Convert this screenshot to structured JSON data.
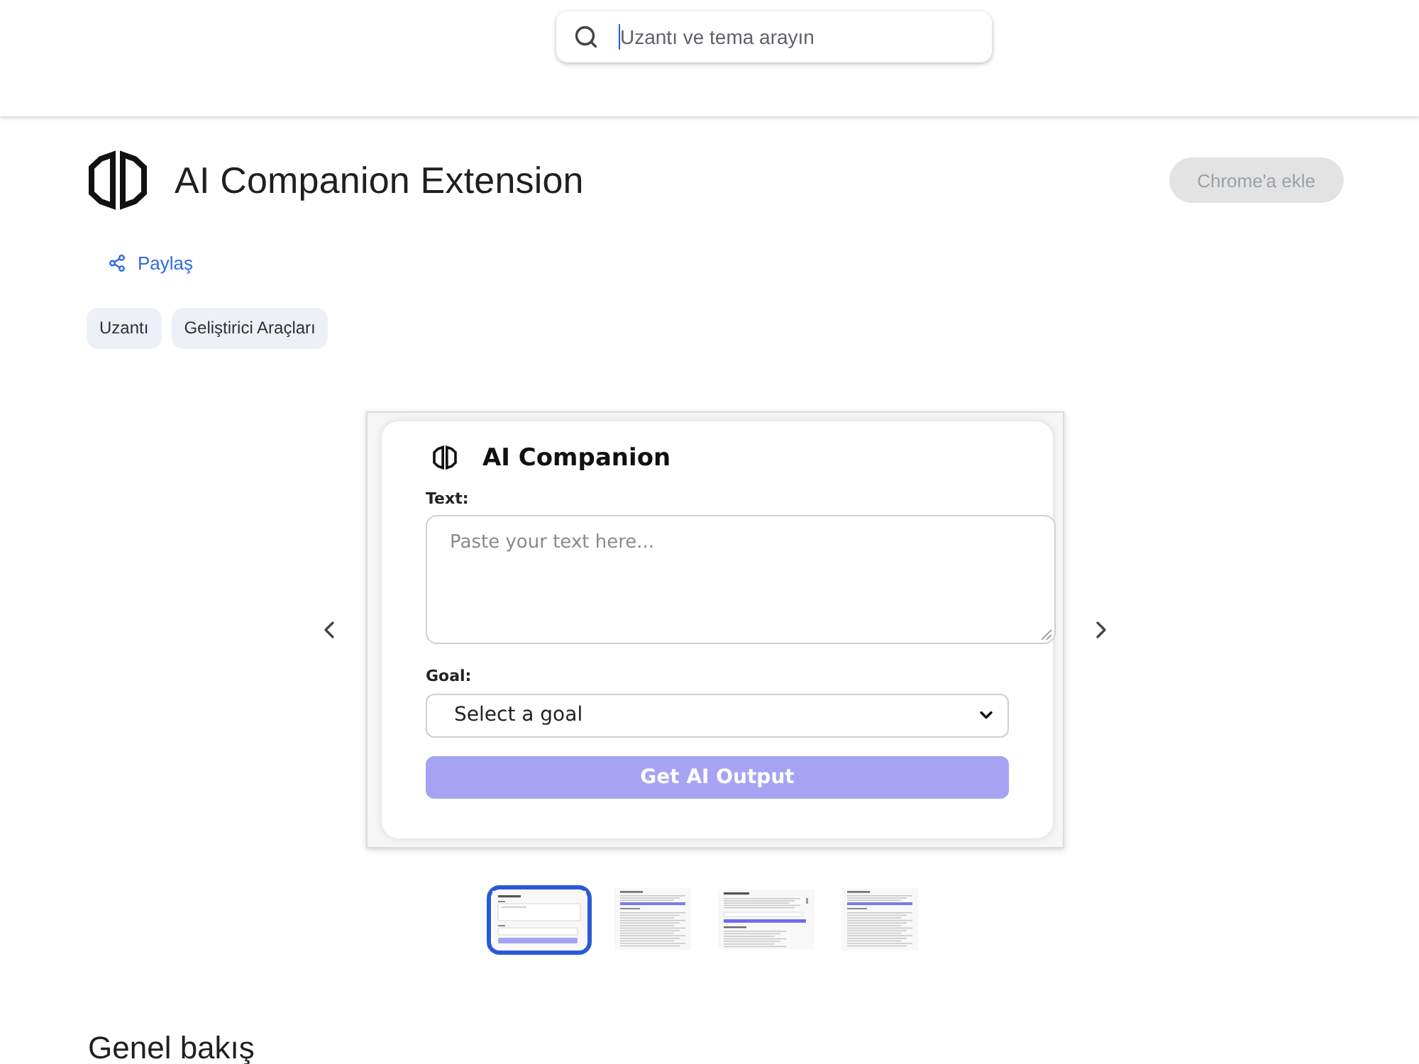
{
  "search": {
    "placeholder": "Uzantı ve tema arayın",
    "focused": true
  },
  "extension": {
    "title": "AI Companion Extension",
    "add_button": {
      "label": "Chrome'a ekle",
      "disabled": true
    },
    "share_link": "Paylaş",
    "categories": [
      "Uzantı",
      "Geliştirici Araçları"
    ]
  },
  "gallery": {
    "screenshot": {
      "app_title": "AI Companion",
      "text_label": "Text:",
      "text_placeholder": "Paste your text here...",
      "goal_label": "Goal:",
      "goal_select": "Select a goal",
      "submit_button": {
        "label": "Get AI Output",
        "disabled": true
      }
    },
    "thumbnails": [
      {
        "kind": "form",
        "selected": true
      },
      {
        "kind": "output",
        "selected": false
      },
      {
        "kind": "filled",
        "selected": false
      },
      {
        "kind": "output",
        "selected": false
      }
    ]
  },
  "overview": {
    "heading": "Genel bakış"
  }
}
